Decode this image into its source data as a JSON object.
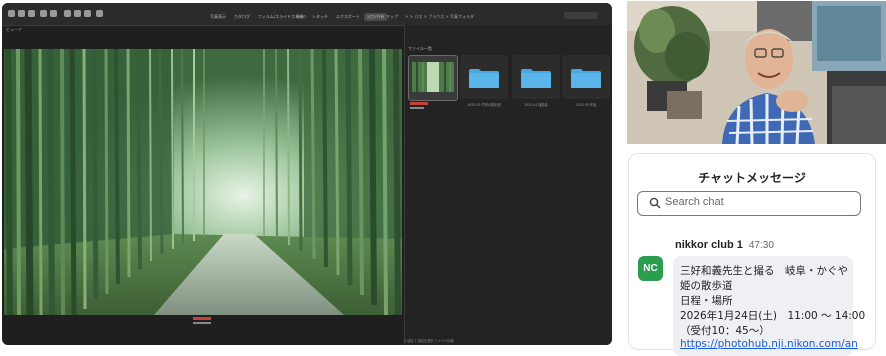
{
  "app": {
    "toolbar_tabs": [
      "写真表示",
      "カタログ",
      "フィルム/スライドスキャン",
      "現像",
      "レタッチ",
      "エクスポート",
      "出力/共有",
      "マップ"
    ],
    "active_tab_index": 6,
    "viewer_label": "ビューア",
    "path": "> > パス > ブラウズ > 写真フォルダ",
    "folder_header": "ファイル一覧",
    "thumbnails": [
      {
        "label": "",
        "type": "photo",
        "selected": true
      },
      {
        "label": "2025 03 竹林の散歩道",
        "type": "folder",
        "selected": false
      },
      {
        "label": "2025 04 撮影会",
        "type": "folder",
        "selected": false
      },
      {
        "label": "2025 05 作品",
        "type": "folder",
        "selected": false
      }
    ],
    "status_text": "4 項目  1 項目を選択  ファイル情報"
  },
  "chat": {
    "title": "チャットメッセージ",
    "search_placeholder": "Search chat",
    "message": {
      "avatar_initials": "NC",
      "sender": "nikkor club 1",
      "time": "47:30",
      "lines": [
        "三好和義先生と撮る　岐阜・かぐや",
        "姫の散歩道",
        "日程・場所",
        "2026年1月24日(土)　11:00 ～ 14:00",
        "（受付10：45～）"
      ],
      "link": "https://photohub.nji.nikon.com/an"
    }
  },
  "colors": {
    "app_bg": "#1f1f1f",
    "folder_blue": "#4aa8e0",
    "avatar_green": "#2a9d4f",
    "link_blue": "#1a5bd6"
  }
}
